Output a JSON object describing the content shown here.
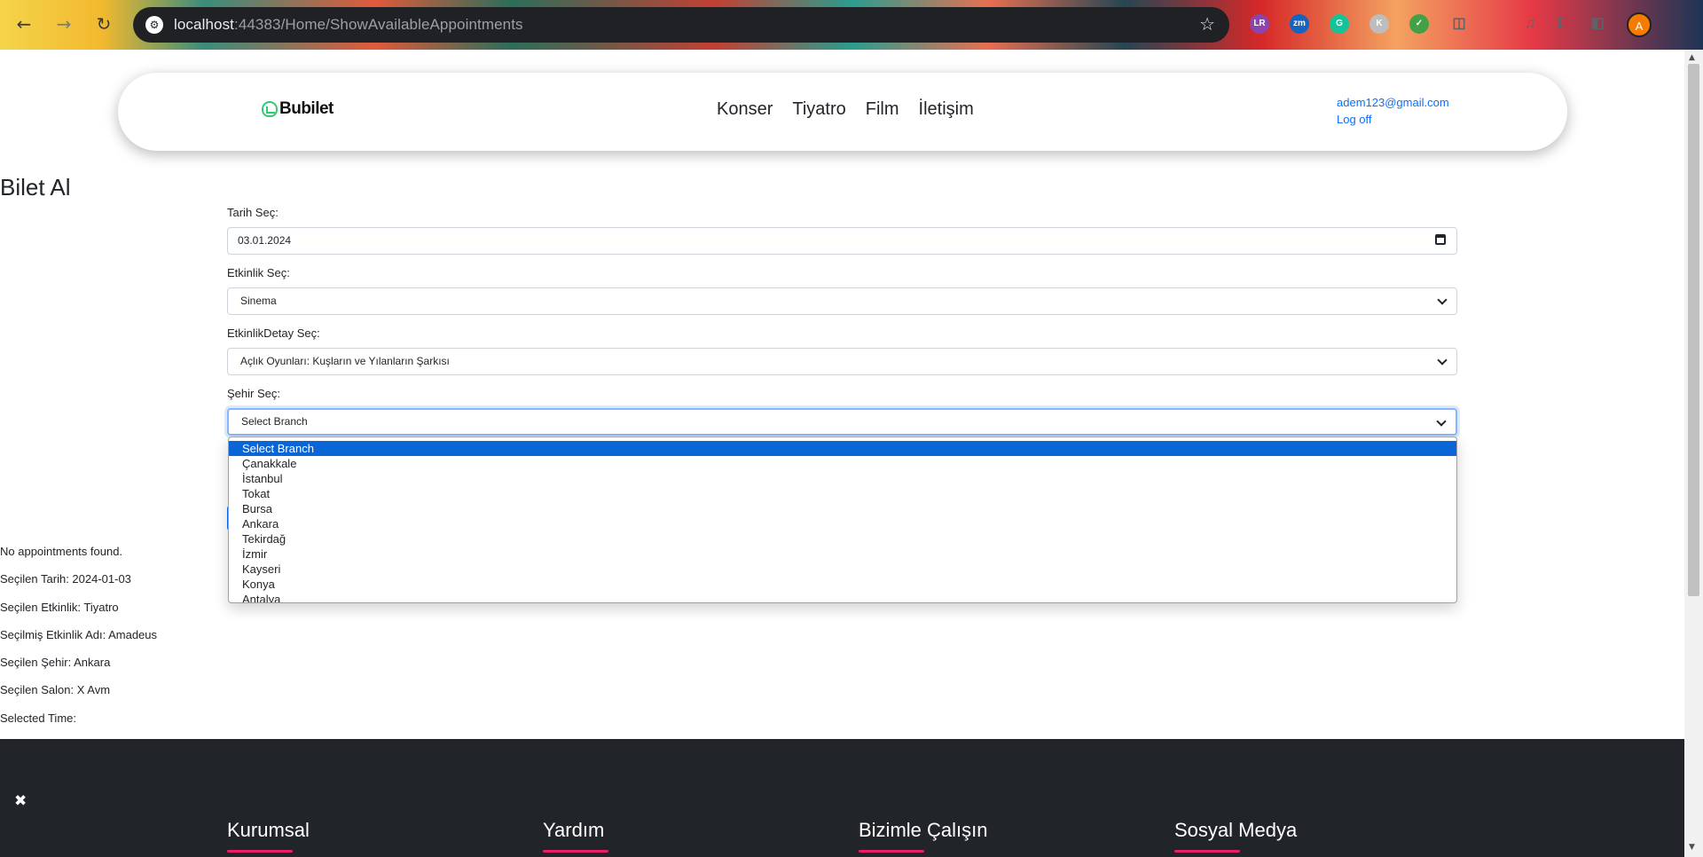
{
  "browser": {
    "url_host": "localhost",
    "url_rest": ":44383/Home/ShowAvailableAppointments",
    "avatar_letter": "A",
    "extensions": [
      "LR",
      "zm",
      "G",
      "K"
    ]
  },
  "navbar": {
    "brand": "Bubilet",
    "links": [
      "Konser",
      "Tiyatro",
      "Film",
      "İletişim"
    ],
    "user_email": "adem123@gmail.com",
    "logoff_label": "Log off"
  },
  "page_title": "Bilet Al",
  "form": {
    "date_label": "Tarih Seç:",
    "date_value": "03.01.2024",
    "event_label": "Etkinlik Seç:",
    "event_value": "Sinema",
    "event_detail_label": "EtkinlikDetay Seç:",
    "event_detail_value": "Açlık Oyunları: Kuşların ve Yılanların Şarkısı",
    "city_label": "Şehir Seç:",
    "city_value": "Select Branch",
    "city_options": [
      "Select Branch",
      "Çanakkale",
      "İstanbul",
      "Tokat",
      "Bursa",
      "Ankara",
      "Tekirdağ",
      "İzmir",
      "Kayseri",
      "Konya",
      "Antalya"
    ]
  },
  "status": {
    "no_appointments": "No appointments found.",
    "selected_date": "Seçilen Tarih: 2024-01-03",
    "selected_event": "Seçilen Etkinlik: Tiyatro",
    "selected_event_name": "Seçilmiş Etkinlik Adı: Amadeus",
    "selected_city": "Seçilen Şehir: Ankara",
    "selected_salon": "Seçilen Salon: X Avm",
    "selected_time": "Selected Time:"
  },
  "footer": {
    "columns": [
      "Kurumsal",
      "Yardım",
      "Bizimle Çalışın",
      "Sosyal Medya"
    ]
  },
  "colors": {
    "accent": "#0d6efd",
    "footer_bg": "#212529",
    "footer_underline": "#e91e63",
    "option_selected": "#0a66d6"
  }
}
